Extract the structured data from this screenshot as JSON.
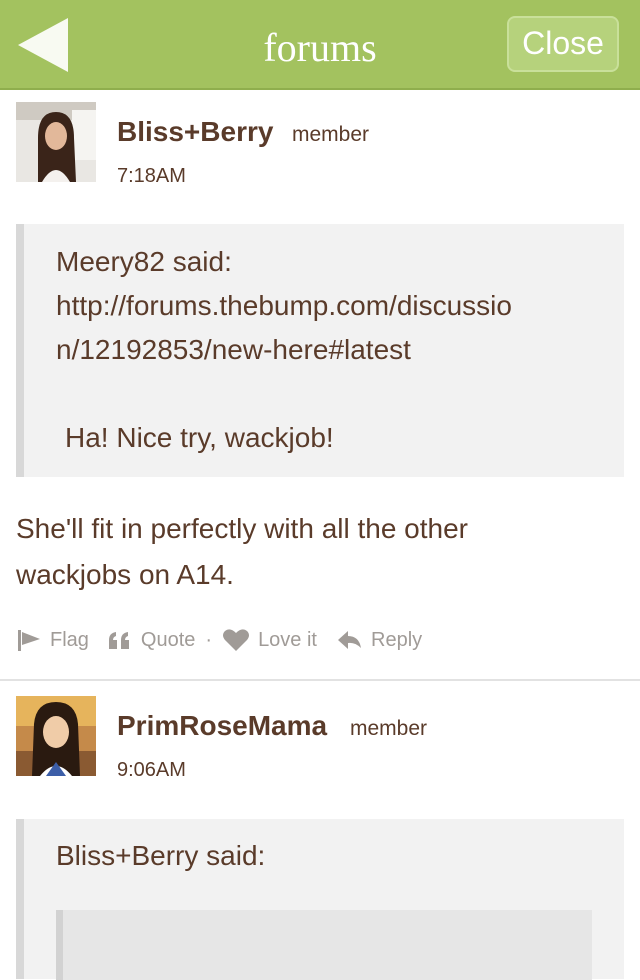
{
  "header": {
    "title": "forums",
    "close_label": "Close",
    "back_icon": "back-arrow-icon"
  },
  "colors": {
    "header_bg": "#a3c25f",
    "text": "#5a3b2a",
    "muted": "#a09b97",
    "quote_bg": "#f2f2f2"
  },
  "posts": [
    {
      "author": "Bliss+Berry",
      "role": "member",
      "time": "7:18AM",
      "quote": {
        "lines": [
          "Meery82 said:",
          "http://forums.thebump.com/discussio",
          "n/12192853/new-here#latest",
          "",
          "Ha! Nice try, wackjob!"
        ]
      },
      "body_lines": [
        "She'll fit in perfectly with all the other",
        "wackjobs on A14."
      ],
      "actions": {
        "flag": "Flag",
        "quote": "Quote",
        "sep": "·",
        "love": "Love it",
        "reply": "Reply"
      }
    },
    {
      "author": "PrimRoseMama",
      "role": "member",
      "time": "9:06AM",
      "quote": {
        "lines": [
          "Bliss+Berry said:"
        ]
      }
    }
  ]
}
